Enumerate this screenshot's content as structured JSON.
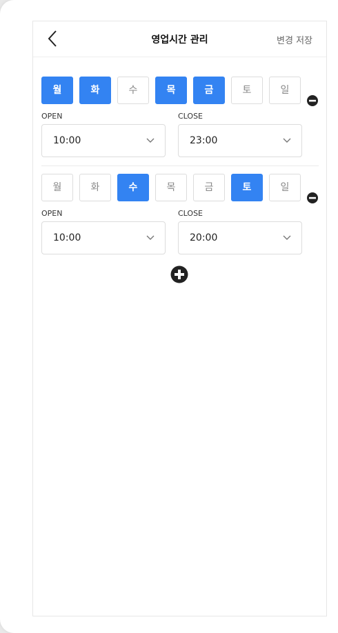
{
  "header": {
    "title": "영업시간 관리",
    "save_label": "변경 저장"
  },
  "colors": {
    "active": "#3383f2",
    "inactive_border": "#dcdcdc"
  },
  "schedules": [
    {
      "days": [
        {
          "label": "월",
          "active": true
        },
        {
          "label": "화",
          "active": true
        },
        {
          "label": "수",
          "active": false
        },
        {
          "label": "목",
          "active": true
        },
        {
          "label": "금",
          "active": true
        },
        {
          "label": "토",
          "active": false
        },
        {
          "label": "일",
          "active": false
        }
      ],
      "open_label": "OPEN",
      "close_label": "CLOSE",
      "open_time": "10:00",
      "close_time": "23:00"
    },
    {
      "days": [
        {
          "label": "월",
          "active": false
        },
        {
          "label": "화",
          "active": false
        },
        {
          "label": "수",
          "active": true
        },
        {
          "label": "목",
          "active": false
        },
        {
          "label": "금",
          "active": false
        },
        {
          "label": "토",
          "active": true
        },
        {
          "label": "일",
          "active": false
        }
      ],
      "open_label": "OPEN",
      "close_label": "CLOSE",
      "open_time": "10:00",
      "close_time": "20:00"
    }
  ],
  "icons": {
    "back": "chevron-left-icon",
    "remove": "minus-circle-icon",
    "add": "plus-circle-icon",
    "dropdown": "chevron-down-icon"
  }
}
